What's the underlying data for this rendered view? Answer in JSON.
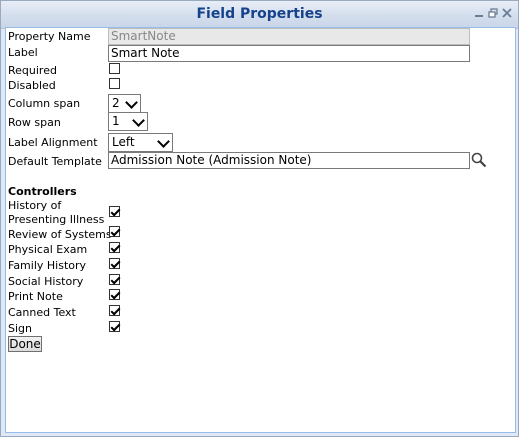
{
  "window": {
    "title": "Field Properties"
  },
  "properties": {
    "property_name_label": "Property Name",
    "property_name_value": "SmartNote",
    "label_label": "Label",
    "label_value": "Smart Note",
    "required_label": "Required",
    "required_checked": false,
    "disabled_label": "Disabled",
    "disabled_checked": false,
    "column_span_label": "Column span",
    "column_span_value": "2",
    "row_span_label": "Row span",
    "row_span_value": "1",
    "label_alignment_label": "Label Alignment",
    "label_alignment_value": "Left",
    "default_template_label": "Default Template",
    "default_template_value": "Admission Note (Admission Note)"
  },
  "controllers": {
    "heading": "Controllers",
    "items": [
      {
        "label_line1": "History of",
        "label_line2": "Presenting Illness",
        "checked": true
      },
      {
        "label": "Review of Systems",
        "checked": true
      },
      {
        "label": "Physical Exam",
        "checked": true
      },
      {
        "label": "Family History",
        "checked": true
      },
      {
        "label": "Social History",
        "checked": true
      },
      {
        "label": "Print Note",
        "checked": true
      },
      {
        "label": "Canned Text",
        "checked": true
      },
      {
        "label": "Sign",
        "checked": true
      }
    ]
  },
  "actions": {
    "done_label": "Done"
  },
  "icons": {
    "search": "magnifier-icon",
    "minimize": "minimize-icon",
    "restore": "restore-icon",
    "close": "close-icon"
  }
}
